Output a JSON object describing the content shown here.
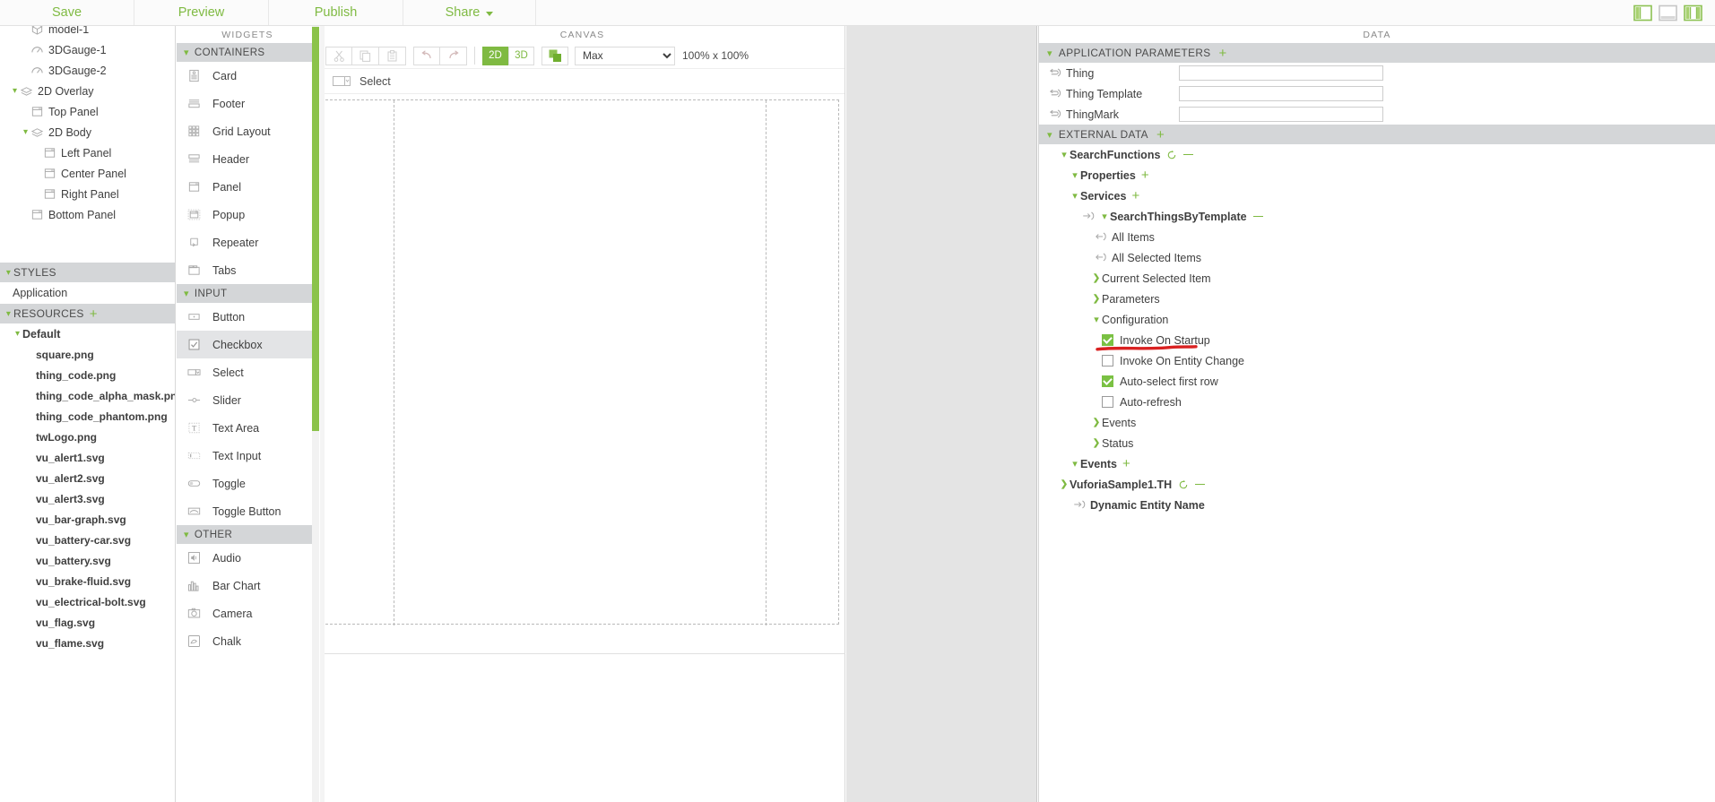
{
  "topbar": {
    "menu": [
      {
        "label": "Save",
        "name": "menu-save"
      },
      {
        "label": "Preview",
        "name": "menu-preview"
      },
      {
        "label": "Publish",
        "name": "menu-publish"
      },
      {
        "label": "Share",
        "name": "menu-share",
        "has_caret": true
      }
    ],
    "layout_icons": [
      "left-panel-layout-icon",
      "center-panel-layout-icon",
      "right-panel-layout-icon"
    ],
    "accent_color": "#7fba42"
  },
  "left_panel": {
    "tree": [
      {
        "label": "model-1",
        "icon": "model-icon",
        "indent": 34,
        "caret": ""
      },
      {
        "label": "3DGauge-1",
        "icon": "gauge-icon",
        "indent": 34,
        "caret": ""
      },
      {
        "label": "3DGauge-2",
        "icon": "gauge-icon",
        "indent": 34,
        "caret": ""
      },
      {
        "label": "2D Overlay",
        "icon": "overlay-icon",
        "indent": 22,
        "caret": "v"
      },
      {
        "label": "Top Panel",
        "icon": "panel-icon",
        "indent": 34,
        "caret": ""
      },
      {
        "label": "2D Body",
        "icon": "overlay-icon",
        "indent": 34,
        "caret": "v"
      },
      {
        "label": "Left Panel",
        "icon": "panel-icon",
        "indent": 48,
        "caret": ""
      },
      {
        "label": "Center Panel",
        "icon": "panel-icon",
        "indent": 48,
        "caret": ""
      },
      {
        "label": "Right Panel",
        "icon": "panel-icon",
        "indent": 48,
        "caret": ""
      },
      {
        "label": "Bottom Panel",
        "icon": "panel-icon",
        "indent": 34,
        "caret": ""
      }
    ],
    "styles_section": {
      "label": "STYLES",
      "caret": "v"
    },
    "styles_items": [
      {
        "label": "Application"
      }
    ],
    "resources_section": {
      "label": "RESOURCES",
      "caret": "v",
      "plus": "+"
    },
    "resources_folder": {
      "label": "Default",
      "caret": "v"
    },
    "resources": [
      "square.png",
      "thing_code.png",
      "thing_code_alpha_mask.png",
      "thing_code_phantom.png",
      "twLogo.png",
      "vu_alert1.svg",
      "vu_alert2.svg",
      "vu_alert3.svg",
      "vu_bar-graph.svg",
      "vu_battery-car.svg",
      "vu_battery.svg",
      "vu_brake-fluid.svg",
      "vu_electrical-bolt.svg",
      "vu_flag.svg",
      "vu_flame.svg"
    ]
  },
  "widgets_panel": {
    "title": "WIDGETS",
    "groups": [
      {
        "label": "CONTAINERS",
        "caret": "v",
        "items": [
          {
            "label": "Card",
            "icon": "card-icon"
          },
          {
            "label": "Footer",
            "icon": "footer-icon"
          },
          {
            "label": "Grid Layout",
            "icon": "grid-layout-icon"
          },
          {
            "label": "Header",
            "icon": "header-icon"
          },
          {
            "label": "Panel",
            "icon": "panel-icon"
          },
          {
            "label": "Popup",
            "icon": "popup-icon"
          },
          {
            "label": "Repeater",
            "icon": "repeater-icon"
          },
          {
            "label": "Tabs",
            "icon": "tabs-icon"
          }
        ]
      },
      {
        "label": "INPUT",
        "caret": "v",
        "items": [
          {
            "label": "Button",
            "icon": "button-icon"
          },
          {
            "label": "Checkbox",
            "icon": "checkbox-icon",
            "selected": true
          },
          {
            "label": "Select",
            "icon": "select-icon"
          },
          {
            "label": "Slider",
            "icon": "slider-icon"
          },
          {
            "label": "Text Area",
            "icon": "text-area-icon"
          },
          {
            "label": "Text Input",
            "icon": "text-input-icon"
          },
          {
            "label": "Toggle",
            "icon": "toggle-icon"
          },
          {
            "label": "Toggle Button",
            "icon": "toggle-button-icon"
          }
        ]
      },
      {
        "label": "OTHER",
        "caret": "v",
        "items": [
          {
            "label": "Audio",
            "icon": "audio-icon"
          },
          {
            "label": "Bar Chart",
            "icon": "bar-chart-icon"
          },
          {
            "label": "Camera",
            "icon": "camera-icon"
          },
          {
            "label": "Chalk",
            "icon": "chalk-icon"
          }
        ]
      }
    ]
  },
  "canvas": {
    "title": "CANVAS",
    "toolbar": {
      "cut": "cut-icon",
      "copy": "copy-icon",
      "paste": "paste-icon",
      "undo": "undo-icon",
      "redo": "redo-icon",
      "mode_2d": "2D",
      "mode_3d": "3D",
      "active_mode": "2D",
      "layers_icon": "layers-icon",
      "size_option": "Max",
      "size_options": [
        "Max"
      ],
      "size_readout": "100% x 100%"
    },
    "placed_widget": {
      "label": "Select",
      "icon": "select-icon"
    }
  },
  "data_panel": {
    "title": "DATA",
    "application_parameters": {
      "section_label": "APPLICATION PARAMETERS",
      "caret": "v",
      "plus": "+",
      "params": [
        {
          "label": "Thing",
          "icon": "binding-icon",
          "value": ""
        },
        {
          "label": "Thing Template",
          "icon": "binding-icon",
          "value": ""
        },
        {
          "label": "ThingMark",
          "icon": "binding-icon",
          "value": ""
        }
      ]
    },
    "external_data": {
      "section_label": "EXTERNAL DATA",
      "caret": "v",
      "plus": "+",
      "tree": [
        {
          "label": "SearchFunctions",
          "indent": 22,
          "caret": "v",
          "refresh": true,
          "dash": true
        },
        {
          "label": "Properties",
          "indent": 34,
          "caret": "v",
          "plus": "+"
        },
        {
          "label": "Services",
          "indent": 34,
          "caret": "v",
          "plus": "+"
        },
        {
          "label": "SearchThingsByTemplate",
          "indent": 46,
          "caret": "v",
          "icon": "service-out-icon",
          "dash": true
        },
        {
          "label": "All Items",
          "indent": 60,
          "icon": "binding-in-icon"
        },
        {
          "label": "All Selected Items",
          "indent": 60,
          "icon": "binding-in-icon"
        },
        {
          "label": "Current Selected Item",
          "indent": 58,
          "caret": ">"
        },
        {
          "label": "Parameters",
          "indent": 58,
          "caret": ">"
        },
        {
          "label": "Configuration",
          "indent": 58,
          "caret": "v"
        },
        {
          "label": "Invoke On Startup",
          "indent": 70,
          "checkbox": true,
          "checked": true,
          "highlighted": true
        },
        {
          "label": "Invoke On Entity Change",
          "indent": 70,
          "checkbox": true,
          "checked": false
        },
        {
          "label": "Auto-select first row",
          "indent": 70,
          "checkbox": true,
          "checked": true
        },
        {
          "label": "Auto-refresh",
          "indent": 70,
          "checkbox": true,
          "checked": false
        },
        {
          "label": "Events",
          "indent": 58,
          "caret": ">"
        },
        {
          "label": "Status",
          "indent": 58,
          "caret": ">"
        },
        {
          "label": "Events",
          "indent": 34,
          "caret": "v",
          "plus": "+"
        },
        {
          "label": "VuforiaSample1.TH",
          "indent": 22,
          "caret": ">",
          "refresh": true,
          "dash": true
        },
        {
          "label": "Dynamic Entity Name",
          "indent": 36,
          "icon": "service-out-icon"
        }
      ]
    },
    "annotation": {
      "type": "red-underline",
      "color": "#d92121",
      "target": "Invoke On Startup"
    }
  }
}
